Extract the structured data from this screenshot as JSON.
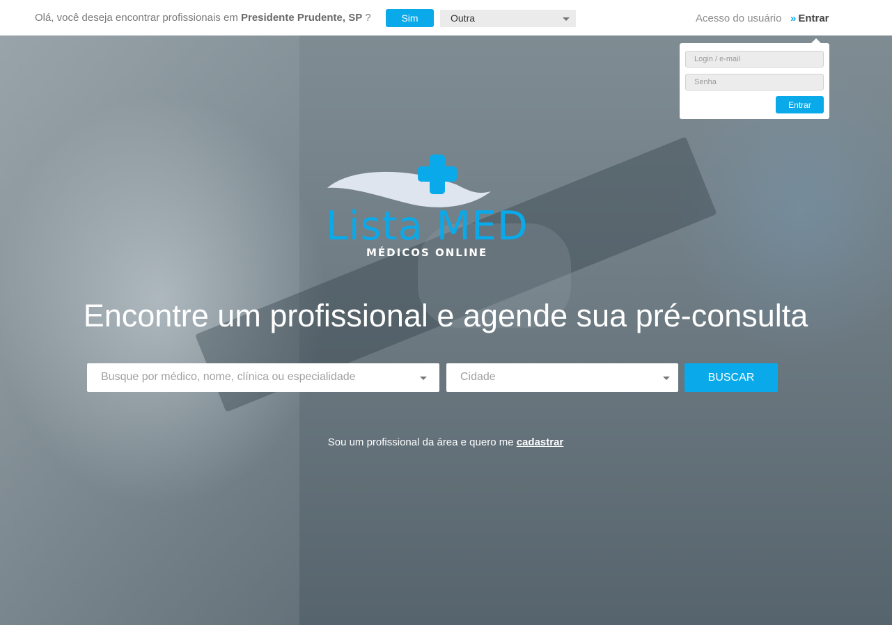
{
  "topbar": {
    "location_question_prefix": "Olá, você deseja encontrar profissionais em",
    "location_city": "Presidente Prudente, SP",
    "location_question_suffix": "?",
    "yes_button": "Sim",
    "other_select_value": "Outra",
    "user_access_label": "Acesso do usuário",
    "login_link": "Entrar"
  },
  "login_popup": {
    "login_placeholder": "Login / e-mail",
    "password_placeholder": "Senha",
    "submit_label": "Entrar"
  },
  "logo": {
    "title": "Lista MED",
    "subtitle": "MÉDICOS ONLINE"
  },
  "hero": {
    "headline": "Encontre um profissional e agende sua pré-consulta"
  },
  "search": {
    "query_placeholder": "Busque por médico, nome, clínica ou especialidade",
    "city_placeholder": "Cidade",
    "search_button": "BUSCAR"
  },
  "signup": {
    "text": "Sou um profissional da área e quero me",
    "link": "cadastrar"
  },
  "colors": {
    "accent": "#0aa9ea",
    "logo_wave": "#dfe5ee"
  },
  "icons": {
    "login_chevron": "double-chevron-right-icon",
    "select_caret": "caret-down-icon",
    "logo_cross": "medical-cross-icon"
  }
}
